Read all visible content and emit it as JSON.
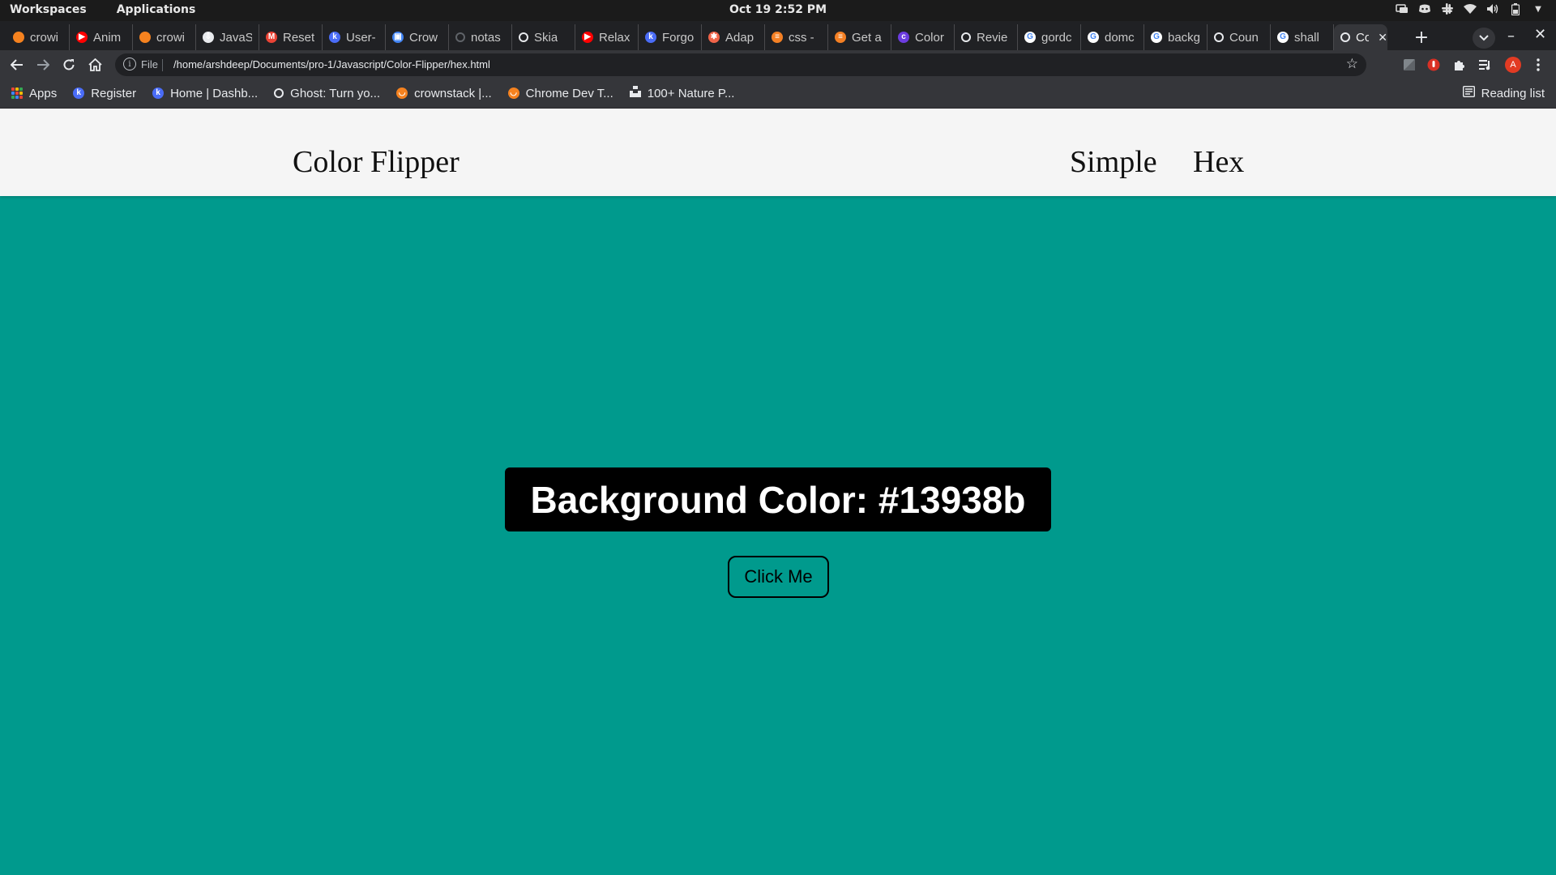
{
  "os": {
    "workspaces": "Workspaces",
    "applications": "Applications",
    "clock": "Oct 19  2:52 PM"
  },
  "browser": {
    "tabs": [
      {
        "title": "crowi",
        "favicon": "crownstack",
        "color": "#f5821f"
      },
      {
        "title": "Anim",
        "favicon": "youtube",
        "color": "#ff0000"
      },
      {
        "title": "crowi",
        "favicon": "crownstack",
        "color": "#f5821f"
      },
      {
        "title": "JavaS",
        "favicon": "code",
        "color": "#e8eaed"
      },
      {
        "title": "Reset",
        "favicon": "gmail",
        "color": "#ea4335"
      },
      {
        "title": "User-",
        "favicon": "k-logo",
        "color": "#4a6cf7"
      },
      {
        "title": "Crow",
        "favicon": "image",
        "color": "#4285f4"
      },
      {
        "title": "notas",
        "favicon": "loading",
        "color": "#5f6368"
      },
      {
        "title": "Skia",
        "favicon": "globe",
        "color": "#e8eaed"
      },
      {
        "title": "Relax",
        "favicon": "youtube",
        "color": "#ff0000"
      },
      {
        "title": "Forgo",
        "favicon": "k-logo",
        "color": "#4a6cf7"
      },
      {
        "title": "Adap",
        "favicon": "asterisk",
        "color": "#f06449"
      },
      {
        "title": "css -",
        "favicon": "stackoverflow",
        "color": "#f48024"
      },
      {
        "title": "Get a",
        "favicon": "stackoverflow",
        "color": "#f48024"
      },
      {
        "title": "Color",
        "favicon": "c-logo",
        "color": "#6c3ce0"
      },
      {
        "title": "Revie",
        "favicon": "globe",
        "color": "#e8eaed"
      },
      {
        "title": "gordc",
        "favicon": "google",
        "color": "#e8eaed"
      },
      {
        "title": "domc",
        "favicon": "google",
        "color": "#e8eaed"
      },
      {
        "title": "backg",
        "favicon": "google",
        "color": "#e8eaed"
      },
      {
        "title": "Coun",
        "favicon": "globe",
        "color": "#e8eaed"
      },
      {
        "title": "shall",
        "favicon": "google",
        "color": "#e8eaed"
      }
    ],
    "active_tab": {
      "title": "Co",
      "favicon": "globe"
    },
    "address": {
      "scheme": "File",
      "url": "/home/arshdeep/Documents/pro-1/Javascript/Color-Flipper/hex.html"
    },
    "profile_initial": "A",
    "bookmarks": [
      {
        "label": "Apps",
        "icon": "apps-grid-icon"
      },
      {
        "label": "Register",
        "icon": "k-logo-icon"
      },
      {
        "label": "Home | Dashb...",
        "icon": "k-logo-icon"
      },
      {
        "label": "Ghost: Turn yo...",
        "icon": "ghost-icon"
      },
      {
        "label": "crownstack |...",
        "icon": "crownstack-icon"
      },
      {
        "label": "Chrome Dev T...",
        "icon": "crownstack-icon"
      },
      {
        "label": "100+ Nature P...",
        "icon": "unsplash-icon"
      }
    ],
    "reading_list": "Reading list"
  },
  "site": {
    "brand": "Color Flipper",
    "nav_links": [
      "Simple",
      "Hex"
    ],
    "color_label": "Background Color: #13938b",
    "background_color": "#009a8d",
    "button_label": "Click Me"
  }
}
